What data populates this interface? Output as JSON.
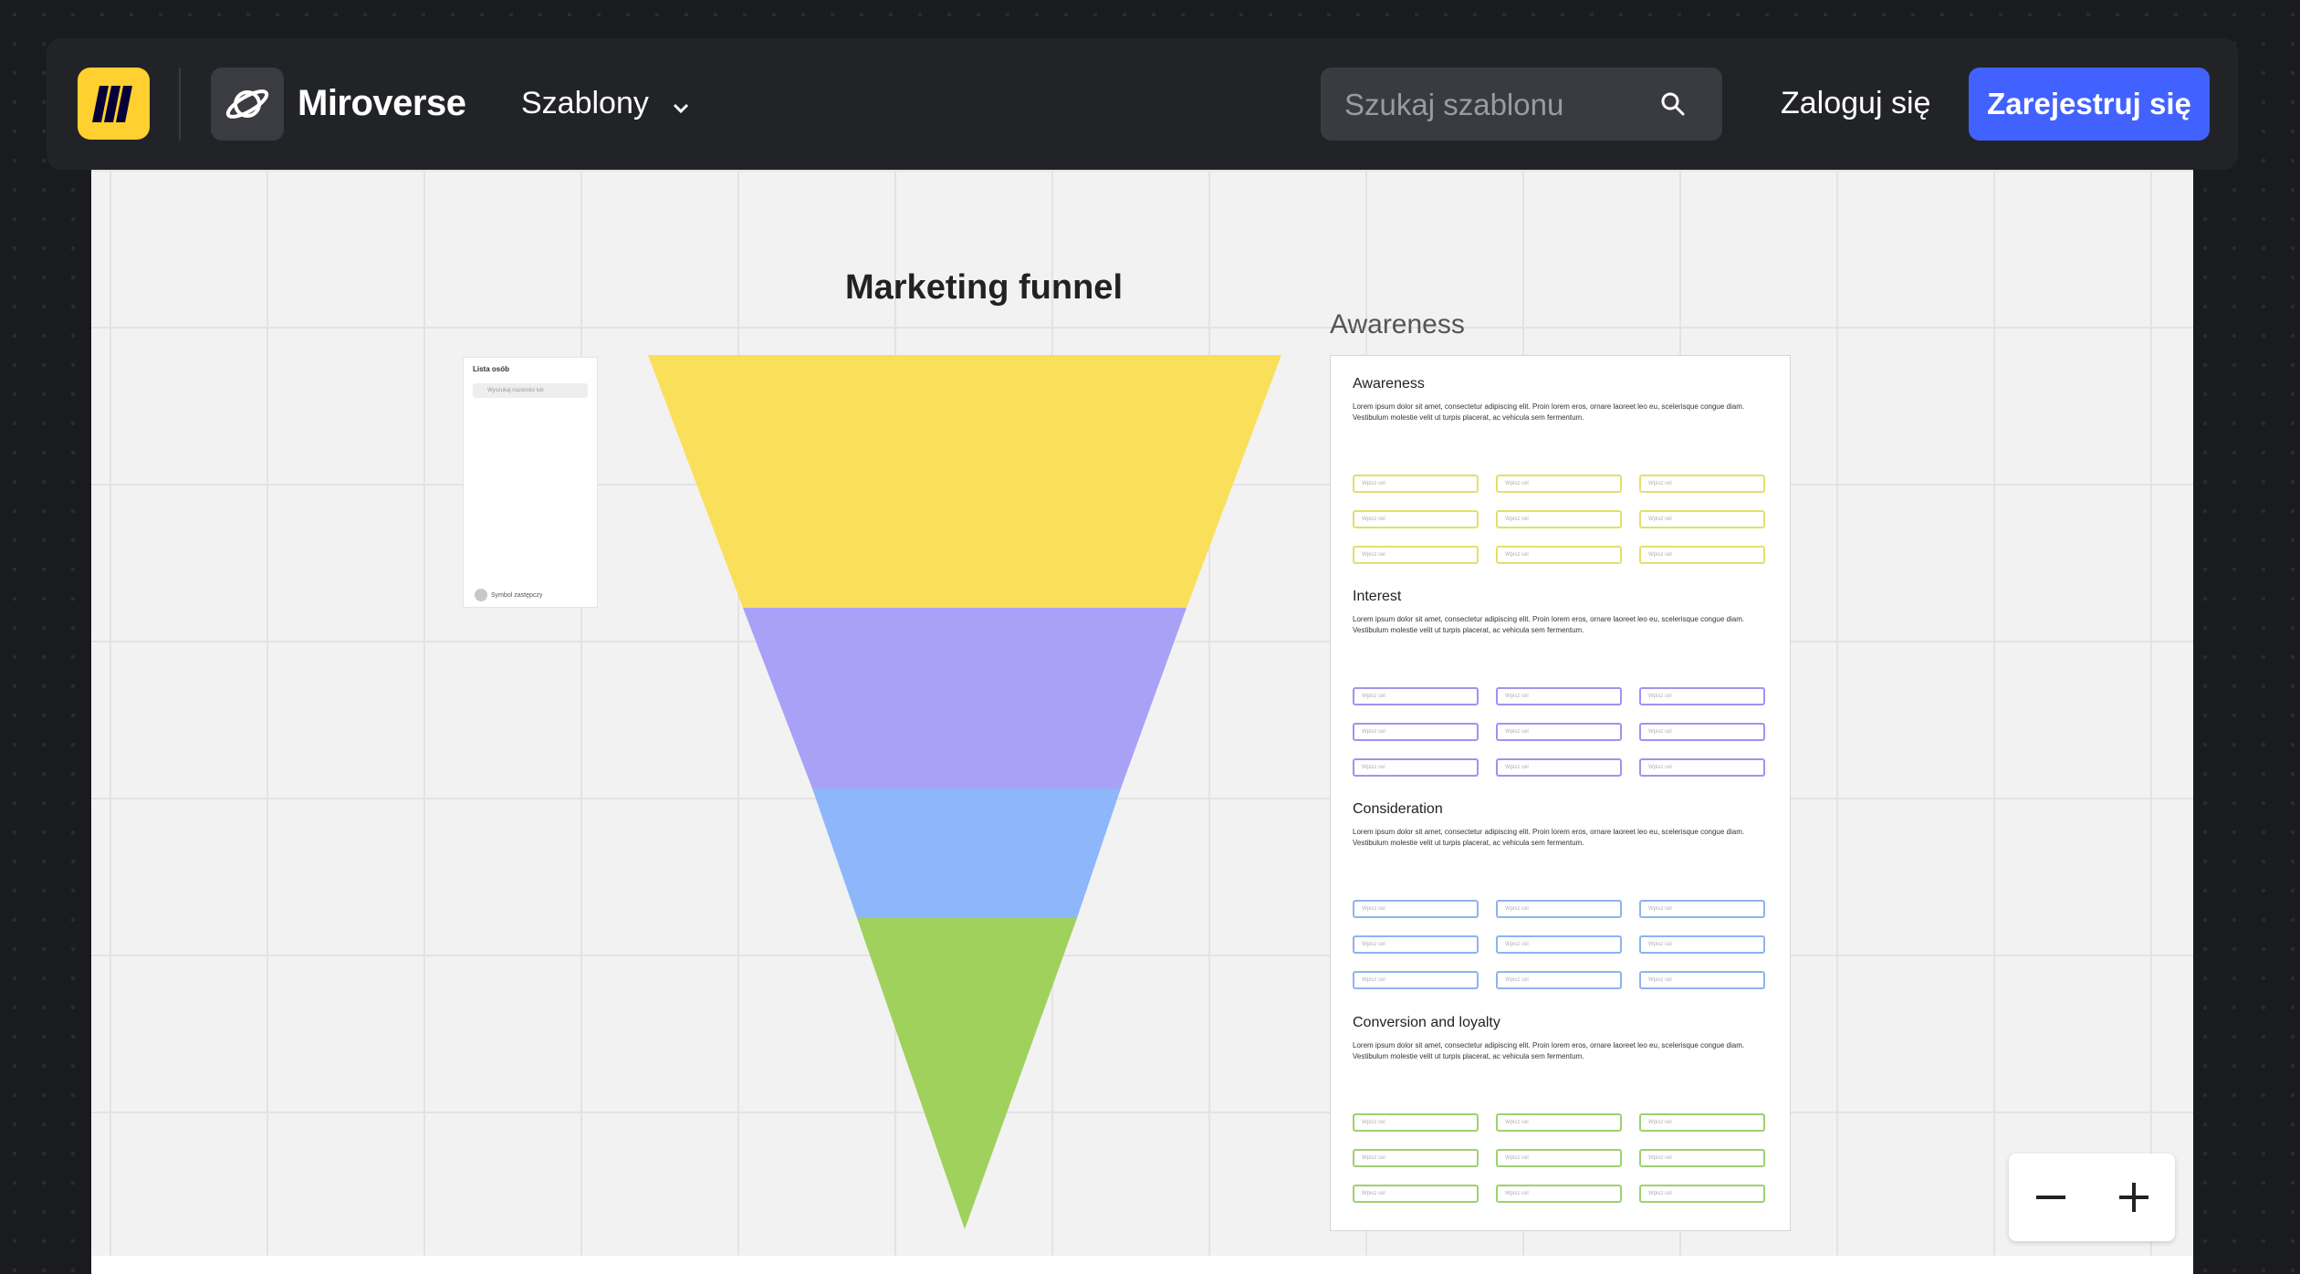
{
  "header": {
    "brand": "Miroverse",
    "templates_label": "Szablony",
    "search_placeholder": "Szukaj szablonu",
    "login_label": "Zaloguj się",
    "signup_label": "Zarejestruj się"
  },
  "colors": {
    "logo_yellow": "#ffd02f",
    "signup_blue": "#4262ff",
    "funnel_awareness": "#fadf5a",
    "funnel_interest": "#a8a1f6",
    "funnel_consideration": "#8db7fa",
    "funnel_conversion": "#a0d15c"
  },
  "canvas": {
    "funnel_title": "Marketing funnel",
    "side_title": "Awareness",
    "people_panel": {
      "title": "Lista osób",
      "search_placeholder": "Wyszukaj nazwisko lub",
      "footer": "Symbol zastępczy"
    },
    "doc": {
      "sections": [
        {
          "title": "Awareness",
          "body": "Lorem ipsum dolor sit amet, consectetur adipiscing elit. Proin lorem eros, ornare laoreet leo eu, scelerisque congue diam. Vestibulum molestie velit ut turpis placerat, ac vehicula sem fermentum.",
          "field_placeholder": "Wpisz cel",
          "color": "#e4df6a"
        },
        {
          "title": "Interest",
          "body": "Lorem ipsum dolor sit amet, consectetur adipiscing elit. Proin lorem eros, ornare laoreet leo eu, scelerisque congue diam. Vestibulum molestie velit ut turpis placerat, ac vehicula sem fermentum.",
          "field_placeholder": "Wpisz cel",
          "color": "#9c95ef"
        },
        {
          "title": "Consideration",
          "body": "Lorem ipsum dolor sit amet, consectetur adipiscing elit. Proin lorem eros, ornare laoreet leo eu, scelerisque congue diam. Vestibulum molestie velit ut turpis placerat, ac vehicula sem fermentum.",
          "field_placeholder": "Wpisz cel",
          "color": "#8fb3ee"
        },
        {
          "title": "Conversion and loyalty",
          "body": "Lorem ipsum dolor sit amet, consectetur adipiscing elit. Proin lorem eros, ornare laoreet leo eu, scelerisque congue diam. Vestibulum molestie velit ut turpis placerat, ac vehicula sem fermentum.",
          "field_placeholder": "Wpisz cel",
          "color": "#9ed070"
        }
      ]
    }
  },
  "zoom": {
    "out_icon": "minus-icon",
    "in_icon": "plus-icon"
  }
}
